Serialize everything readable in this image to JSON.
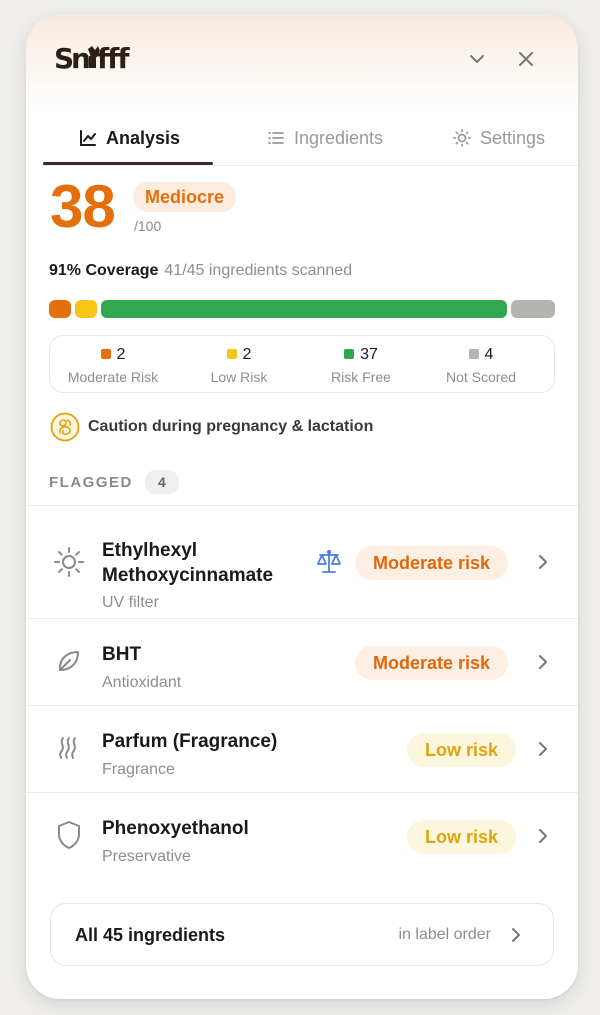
{
  "app": {
    "logo_text": "Sniff"
  },
  "header": {
    "collapse_icon": "chevron-down-icon",
    "close_icon": "close-icon"
  },
  "tabs": [
    {
      "label": "Analysis",
      "icon": "chart-line-icon",
      "active": true
    },
    {
      "label": "Ingredients",
      "icon": "list-icon",
      "active": false
    },
    {
      "label": "Settings",
      "icon": "sun-gear-icon",
      "active": false
    }
  ],
  "score": {
    "value": "38",
    "rating": "Mediocre",
    "max": "/100"
  },
  "coverage": {
    "label": "91% Coverage",
    "detail": "41/45 ingredients scanned"
  },
  "risk_bar": {
    "total": 45,
    "segments": [
      {
        "key": "moderate",
        "count": 2,
        "color": "#e56f0c"
      },
      {
        "key": "low",
        "count": 2,
        "color": "#f5c518"
      },
      {
        "key": "free",
        "count": 37,
        "color": "#2fa84f"
      },
      {
        "key": "unscored",
        "count": 4,
        "color": "#b5b3b0"
      }
    ]
  },
  "legend": [
    {
      "count": "2",
      "label": "Moderate Risk",
      "color": "#e56f0c"
    },
    {
      "count": "2",
      "label": "Low Risk",
      "color": "#f5c518"
    },
    {
      "count": "37",
      "label": "Risk Free",
      "color": "#2fa84f"
    },
    {
      "count": "4",
      "label": "Not Scored",
      "color": "#b5b3b0"
    }
  ],
  "caution": {
    "icon": "pregnancy-icon",
    "text": "Caution during pregnancy & lactation"
  },
  "flagged": {
    "title": "FLAGGED",
    "count": "4",
    "items": [
      {
        "name_line1": "Ethylhexyl",
        "name_line2": "Methoxycinnamate",
        "category": "UV filter",
        "icon": "sun-icon",
        "extra_icon": "scale-icon",
        "risk": "Moderate risk",
        "level": "moderate"
      },
      {
        "name_line1": "BHT",
        "category": "Antioxidant",
        "icon": "leaf-icon",
        "risk": "Moderate risk",
        "level": "moderate"
      },
      {
        "name_line1": "Parfum (Fragrance)",
        "category": "Fragrance",
        "icon": "scent-waves-icon",
        "risk": "Low risk",
        "level": "low"
      },
      {
        "name_line1": "Phenoxyethanol",
        "category": "Preservative",
        "icon": "shield-icon",
        "risk": "Low risk",
        "level": "low"
      }
    ]
  },
  "all_ingredients": {
    "label": "All 45 ingredients",
    "hint": "in label order"
  }
}
